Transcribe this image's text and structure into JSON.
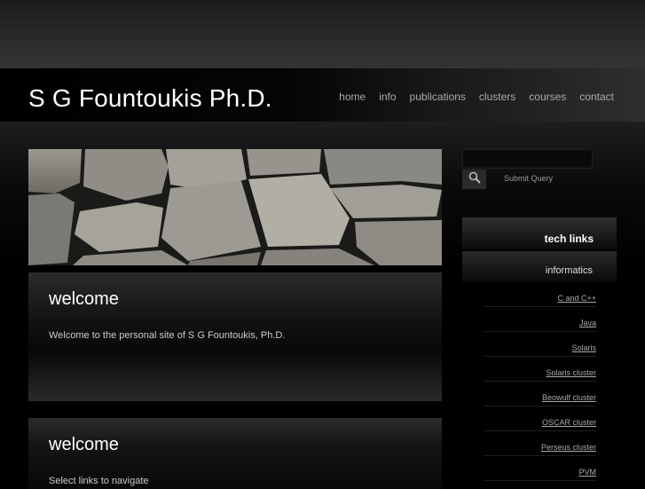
{
  "site": {
    "title": "S G Fountoukis Ph.D."
  },
  "nav": [
    "home",
    "info",
    "publications",
    "clusters",
    "courses",
    "contact"
  ],
  "search": {
    "placeholder": "",
    "button_label": "Submit Query"
  },
  "sidebar": {
    "heading": "tech links",
    "subheading": "informatics",
    "links": [
      "C and C++",
      "Java",
      "Solaris",
      "Solaris cluster",
      "Beowulf cluster",
      "OSCAR cluster",
      "Perseus cluster",
      "PVM"
    ]
  },
  "main": {
    "panels": [
      {
        "title": "welcome",
        "text": "Welcome to the personal site of S G Fountoukis, Ph.D."
      },
      {
        "title": "welcome",
        "text": "Select links to navigate"
      }
    ]
  }
}
